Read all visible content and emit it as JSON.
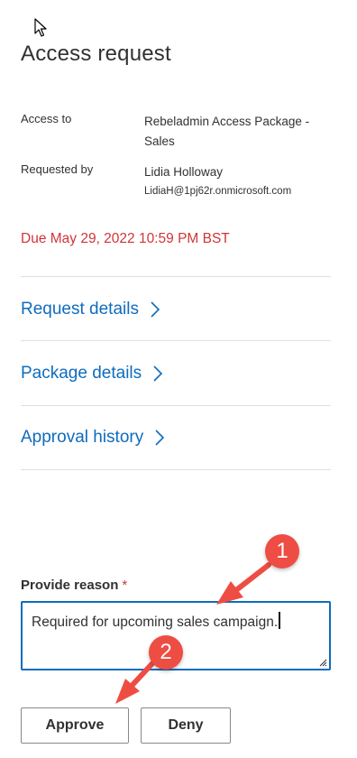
{
  "panel": {
    "title": "Access request"
  },
  "details": {
    "access_to_label": "Access to",
    "access_to_value": "Rebeladmin Access Package - Sales",
    "requested_by_label": "Requested by",
    "requested_by_name": "Lidia Holloway",
    "requested_by_email": "LidiaH@1pj62r.onmicrosoft.com"
  },
  "due": {
    "text": "Due May 29, 2022 10:59 PM BST",
    "color": "#d13438"
  },
  "sections": [
    {
      "label": "Request details"
    },
    {
      "label": "Package details"
    },
    {
      "label": "Approval history"
    }
  ],
  "reason": {
    "label": "Provide reason",
    "required_marker": "*",
    "value": "Required for upcoming sales campaign."
  },
  "actions": {
    "approve_label": "Approve",
    "deny_label": "Deny"
  },
  "annotations": [
    {
      "number": "1"
    },
    {
      "number": "2"
    }
  ],
  "colors": {
    "link": "#0f6cbd",
    "annotation": "#ee4d43",
    "required": "#d13438"
  },
  "icons": {
    "cursor": "mouse-pointer-icon",
    "chevron": "chevron-right-icon",
    "resize": "resize-handle-icon"
  }
}
